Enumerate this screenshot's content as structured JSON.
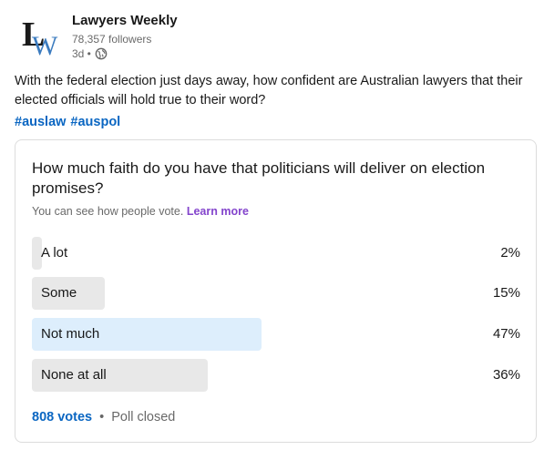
{
  "author": {
    "name": "Lawyers Weekly",
    "followers": "78,357 followers",
    "age": "3d •",
    "logo_letters": [
      "L",
      "W"
    ]
  },
  "post": {
    "text": "With the federal election just days away, how confident are Australian lawyers that their elected officials will hold true to their word?",
    "hashtags": [
      "#auslaw",
      "#auspol"
    ]
  },
  "poll": {
    "question": "How much faith do you have that politicians will deliver on election promises?",
    "visibility_text": "You can see how people vote.",
    "learn_more": "Learn more",
    "options": [
      {
        "label": "A lot",
        "percent": "2%",
        "value": 2,
        "selected": false
      },
      {
        "label": "Some",
        "percent": "15%",
        "value": 15,
        "selected": false
      },
      {
        "label": "Not much",
        "percent": "47%",
        "value": 47,
        "selected": true
      },
      {
        "label": "None at all",
        "percent": "36%",
        "value": 36,
        "selected": false
      }
    ],
    "votes": "808 votes",
    "separator": "•",
    "status": "Poll closed"
  },
  "colors": {
    "link": "#0a66c2",
    "learn_more": "#8344cc",
    "bar": "#e8e8e8",
    "bar_selected": "#ddeefc"
  },
  "icons": {
    "globe": "globe-icon"
  }
}
